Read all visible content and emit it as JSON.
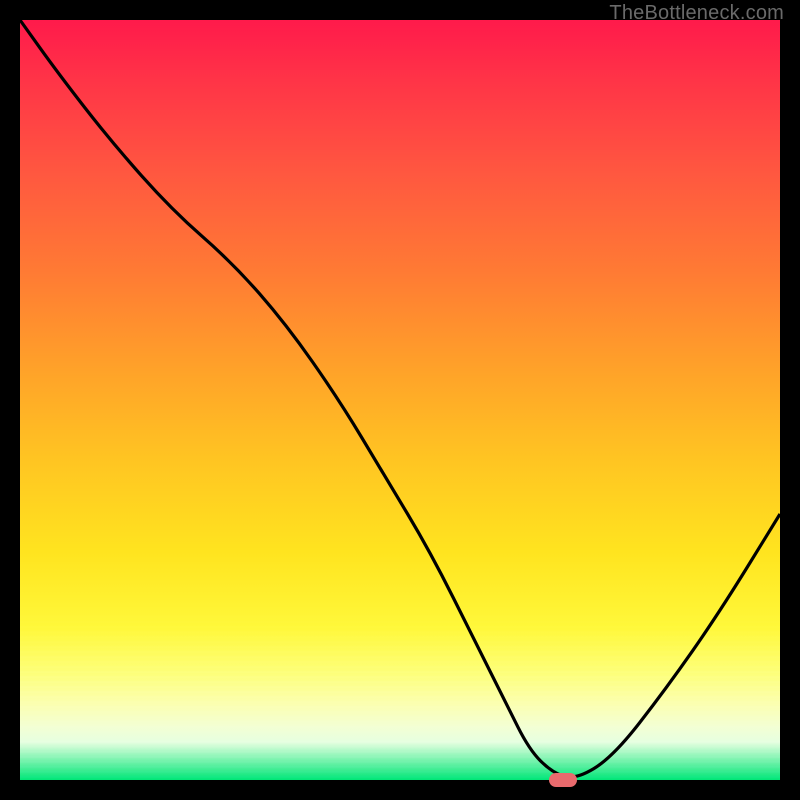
{
  "watermark": "TheBottleneck.com",
  "colors": {
    "curve": "#000000",
    "marker": "#e96a6d"
  },
  "chart_data": {
    "type": "line",
    "title": "",
    "xlabel": "",
    "ylabel": "",
    "xlim": [
      0,
      100
    ],
    "ylim": [
      0,
      100
    ],
    "x": [
      0,
      5,
      12,
      20,
      28,
      35,
      42,
      48,
      54,
      60,
      64,
      67,
      70,
      73,
      78,
      85,
      92,
      100
    ],
    "values": [
      100,
      93,
      84,
      75,
      68,
      60,
      50,
      40,
      30,
      18,
      10,
      4,
      1,
      0,
      3,
      12,
      22,
      35
    ],
    "marker": {
      "x": 71.5,
      "y": 0
    },
    "note": "values are approximate readings of the black curve as percent of plot height from bottom; marker is the red capsule position"
  }
}
